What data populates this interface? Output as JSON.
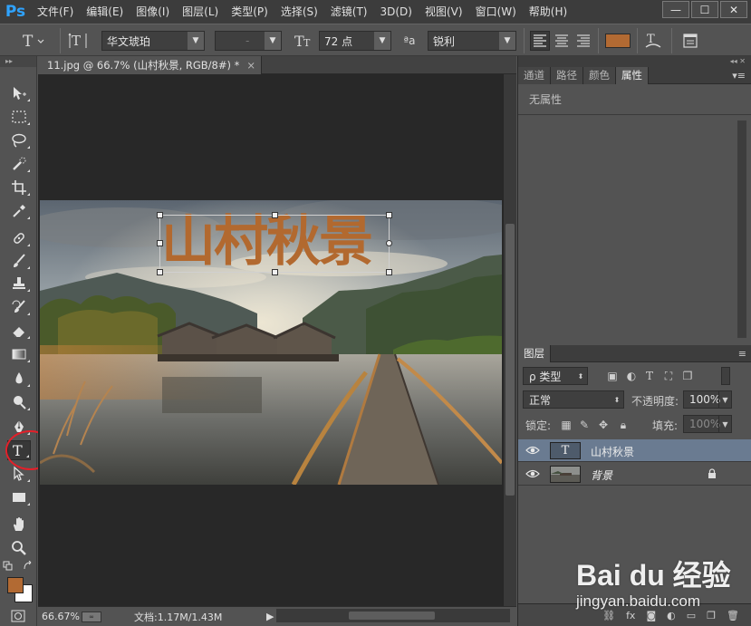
{
  "app": {
    "logo": "Ps",
    "menu": [
      "文件(F)",
      "编辑(E)",
      "图像(I)",
      "图层(L)",
      "类型(P)",
      "选择(S)",
      "滤镜(T)",
      "3D(D)",
      "视图(V)",
      "窗口(W)",
      "帮助(H)"
    ],
    "window_controls": [
      "—",
      "☐",
      "✕"
    ]
  },
  "options": {
    "font_family": "华文琥珀",
    "font_style": "-",
    "font_size": "72 点",
    "antialias_label": "ªa",
    "antialias": "锐利",
    "text_color": "#b26a33"
  },
  "document": {
    "tab_title": "11.jpg @ 66.7% (山村秋景, RGB/8#) *",
    "overlay_text": "山村秋景",
    "text_color": "#b2692f"
  },
  "status": {
    "zoom": "66.67%",
    "doc_info": "文档:1.17M/1.43M"
  },
  "panels": {
    "top_tabs": [
      "通道",
      "路径",
      "颜色",
      "属性"
    ],
    "active_top_tab": "属性",
    "no_properties": "无属性",
    "layers_tab": "图层",
    "filter_kind": "ρ 类型",
    "blend_mode": "正常",
    "opacity_label": "不透明度:",
    "opacity_value": "100%",
    "lock_label": "锁定:",
    "fill_label": "填充:",
    "fill_value": "100%",
    "layers": [
      {
        "name": "山村秋景",
        "type": "text",
        "selected": true
      },
      {
        "name": "背景",
        "type": "image",
        "locked": true
      }
    ]
  },
  "watermark": {
    "brand": "Bai du 经验",
    "url": "jingyan.baidu.com"
  },
  "colors": {
    "foreground": "#b26a33",
    "background": "#ffffff",
    "highlight_circle": "#e3202a"
  }
}
